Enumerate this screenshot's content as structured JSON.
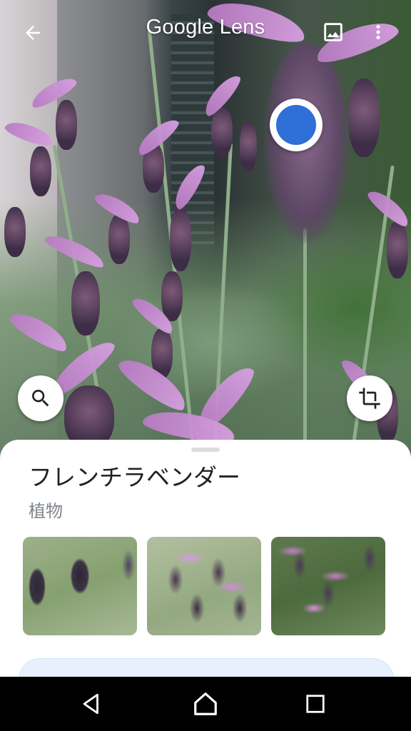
{
  "header": {
    "title": "Google Lens",
    "back_icon": "arrow-back-icon",
    "gallery_icon": "image-icon",
    "more_icon": "more-vert-icon"
  },
  "camera": {
    "indicator_color": "#2f6fd8",
    "search_icon": "search-icon",
    "crop_icon": "crop-icon"
  },
  "result": {
    "title": "フレンチラベンダー",
    "subtitle": "植物",
    "thumbnails": [
      {
        "icon": "lavender-photo-1"
      },
      {
        "icon": "lavender-photo-2"
      },
      {
        "icon": "lavender-photo-3"
      }
    ]
  },
  "navbar": {
    "back_icon": "nav-back-icon",
    "home_icon": "nav-home-icon",
    "recent_icon": "nav-recents-icon"
  },
  "colors": {
    "accent": "#2f6fd8",
    "sheet_bg": "#ffffff",
    "title_text": "#202124",
    "subtitle_text": "#80868b"
  }
}
